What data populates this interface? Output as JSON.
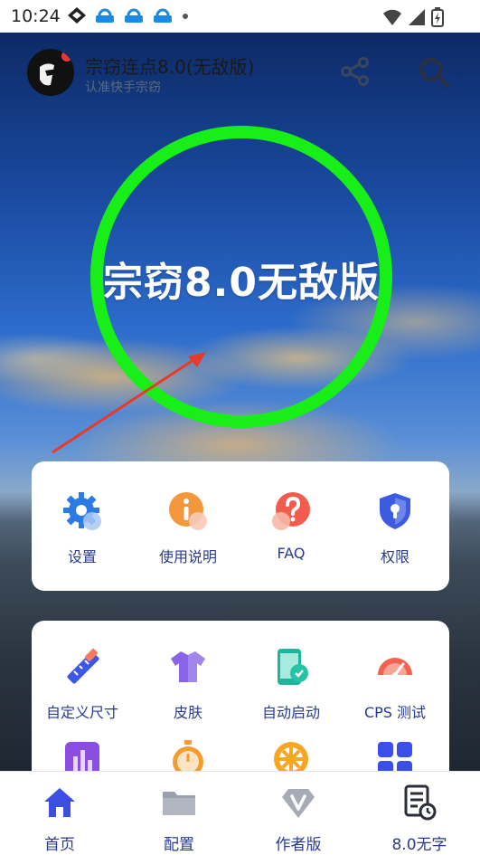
{
  "status_bar": {
    "time": "10:24"
  },
  "header": {
    "title": "宗窃连点8.0(无敌版)",
    "subtitle": "认准快手宗窃"
  },
  "hero": {
    "label": "宗窃8.0无敌版"
  },
  "card1": {
    "items": [
      {
        "label": "设置",
        "icon": "gear-icon"
      },
      {
        "label": "使用说明",
        "icon": "info-icon"
      },
      {
        "label": "FAQ",
        "icon": "question-icon"
      },
      {
        "label": "权限",
        "icon": "shield-icon"
      }
    ]
  },
  "card2": {
    "items": [
      {
        "label": "自定义尺寸",
        "icon": "ruler-icon"
      },
      {
        "label": "皮肤",
        "icon": "shirt-icon"
      },
      {
        "label": "自动启动",
        "icon": "phone-icon"
      },
      {
        "label": "CPS 测试",
        "icon": "speedometer-icon"
      }
    ]
  },
  "tabs": [
    {
      "label": "首页",
      "icon": "home-icon"
    },
    {
      "label": "配置",
      "icon": "folder-icon"
    },
    {
      "label": "作者版",
      "icon": "diamond-v-icon"
    },
    {
      "label": "8.0无字",
      "icon": "document-clock-icon"
    }
  ]
}
